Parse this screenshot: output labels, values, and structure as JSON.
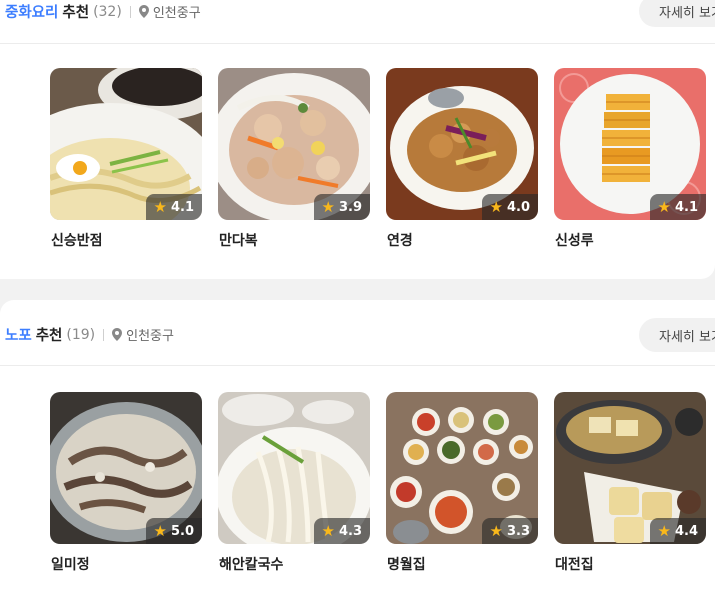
{
  "sections": [
    {
      "keyword": "중화요리",
      "recommend": "추천",
      "count": "(32)",
      "location": "인천중구",
      "more": "자세히 보기",
      "cards": [
        {
          "name": "신승반점",
          "rating": "4.1"
        },
        {
          "name": "만다복",
          "rating": "3.9"
        },
        {
          "name": "연경",
          "rating": "4.0"
        },
        {
          "name": "신성루",
          "rating": "4.1"
        }
      ]
    },
    {
      "keyword": "노포",
      "recommend": "추천",
      "count": "(19)",
      "location": "인천중구",
      "more": "자세히 보기",
      "cards": [
        {
          "name": "일미정",
          "rating": "5.0"
        },
        {
          "name": "해안칼국수",
          "rating": "4.3"
        },
        {
          "name": "명월집",
          "rating": "3.3"
        },
        {
          "name": "대전집",
          "rating": "4.4"
        }
      ]
    }
  ],
  "colors": {
    "accent": "#3d7eff",
    "star": "#f9b81b"
  }
}
